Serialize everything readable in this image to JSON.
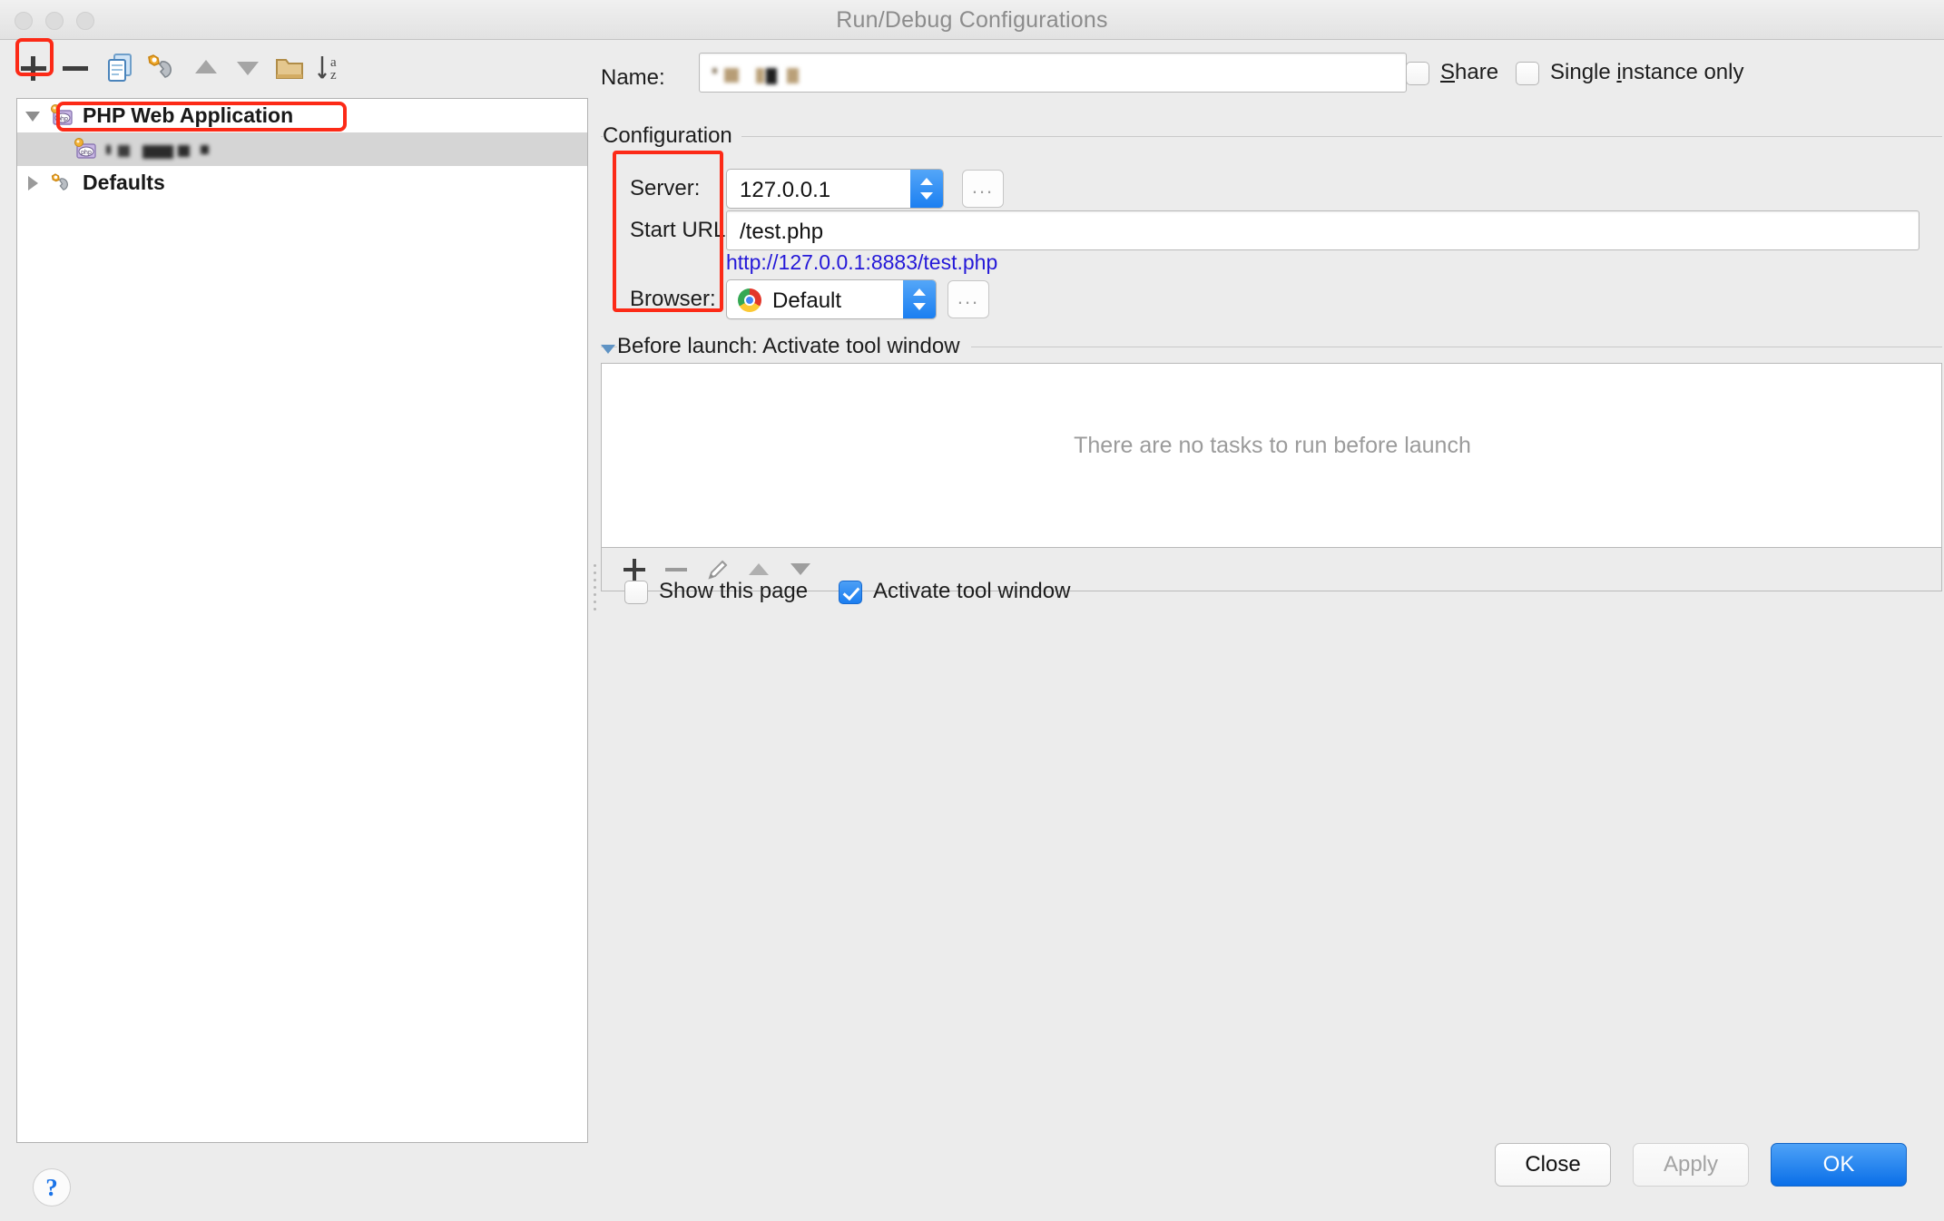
{
  "window": {
    "title": "Run/Debug Configurations",
    "traffic_lights": [
      "close",
      "minimize",
      "zoom"
    ]
  },
  "toolbar": {
    "buttons": [
      {
        "name": "add",
        "icon": "plus-icon",
        "label": "+",
        "highlighted": true
      },
      {
        "name": "remove",
        "icon": "minus-icon",
        "label": "−"
      },
      {
        "name": "copy",
        "icon": "copy-configuration-icon",
        "label": ""
      },
      {
        "name": "edit-defaults",
        "icon": "wrench-icon",
        "label": ""
      },
      {
        "name": "move-up",
        "icon": "triangle-up-icon",
        "label": ""
      },
      {
        "name": "move-down",
        "icon": "triangle-down-icon",
        "label": ""
      },
      {
        "name": "create-folder",
        "icon": "folder-icon",
        "label": ""
      },
      {
        "name": "sort-alphabetically",
        "icon": "sort-az-icon",
        "label": ""
      }
    ]
  },
  "sidebar": {
    "tree": [
      {
        "label": "PHP Web Application",
        "icon": "php-web-application-icon",
        "expanded": true,
        "selected": false,
        "highlighted": true
      },
      {
        "label": "",
        "icon": "php-web-application-icon",
        "redacted": true,
        "selected": true,
        "child": true
      },
      {
        "label": "Defaults",
        "icon": "wrench-icon",
        "expanded": false,
        "selected": false
      }
    ]
  },
  "help": {
    "label": "?"
  },
  "form": {
    "name_label": "Name:",
    "name_value": "",
    "name_redacted": true,
    "share": {
      "label": "Share",
      "mnemonic": "S",
      "checked": false
    },
    "single_instance": {
      "label": "Single instance only",
      "mnemonic": "i",
      "checked": false
    }
  },
  "configuration": {
    "legend": "Configuration",
    "labels_highlighted": true,
    "server": {
      "label": "Server:",
      "value": "127.0.0.1",
      "browse_label": "...",
      "options": [
        "127.0.0.1"
      ]
    },
    "start_url": {
      "label": "Start URL:",
      "value": "/test.php"
    },
    "resolved_url": "http://127.0.0.1:8883/test.php",
    "browser": {
      "label": "Browser:",
      "value": "Default",
      "icon": "chrome-icon",
      "browse_label": "...",
      "options": [
        "Default"
      ]
    }
  },
  "before_launch": {
    "legend": "Before launch: Activate tool window",
    "expanded": true,
    "empty_message": "There are no tasks to run before launch",
    "toolbar": [
      {
        "name": "add-task",
        "icon": "plus-icon",
        "enabled": true
      },
      {
        "name": "remove-task",
        "icon": "minus-icon",
        "enabled": false
      },
      {
        "name": "edit-task",
        "icon": "pencil-icon",
        "enabled": false
      },
      {
        "name": "move-task-up",
        "icon": "triangle-up-icon",
        "enabled": false
      },
      {
        "name": "move-task-down",
        "icon": "triangle-down-icon",
        "enabled": false
      }
    ],
    "show_this_page": {
      "label": "Show this page",
      "checked": false
    },
    "activate_tool_window": {
      "label": "Activate tool window",
      "checked": true
    }
  },
  "footer": {
    "close": {
      "label": "Close",
      "enabled": true
    },
    "apply": {
      "label": "Apply",
      "enabled": false
    },
    "ok": {
      "label": "OK",
      "enabled": true,
      "default": true
    }
  },
  "colors": {
    "accent_blue": "#1b7ef0",
    "link_blue": "#2418d8",
    "highlight_red": "#fc2a17",
    "window_bg": "#ececec"
  }
}
